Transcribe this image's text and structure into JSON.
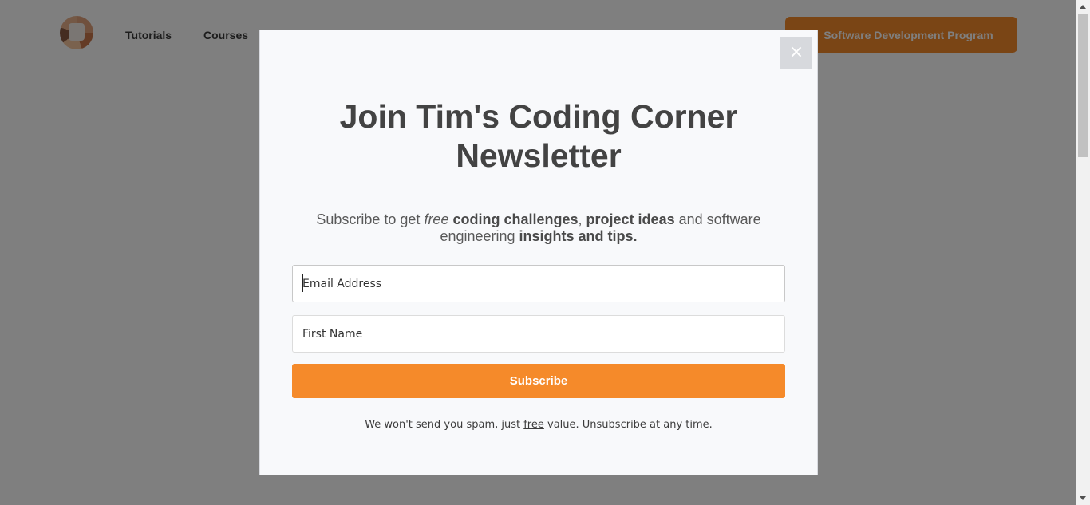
{
  "header": {
    "nav": {
      "tutorials_label": "Tutorials",
      "courses_label": "Courses"
    },
    "cta_label": "Software Development Program"
  },
  "modal": {
    "close_label": "×",
    "title": "Join Tim's Coding Corner Newsletter",
    "subtitle": {
      "prefix": "Subscribe to get ",
      "free": "free",
      "coding_challenges": "coding challenges",
      "comma": ", ",
      "project_ideas": "project ideas",
      "middle": " and software engineering ",
      "insights": "insights and tips."
    },
    "email_field": {
      "placeholder": "Email Address",
      "value": ""
    },
    "first_name_field": {
      "placeholder": "First Name",
      "value": ""
    },
    "subscribe_label": "Subscribe",
    "disclaimer": {
      "prefix": "We won't send you spam, just ",
      "free": "free",
      "suffix": " value. Unsubscribe at any time."
    }
  },
  "colors": {
    "accent": "#f58a2a",
    "overlay": "rgba(0,0,0,0.5)",
    "modal_background": "#f8f9fb",
    "title_text": "#434343"
  },
  "icons": {
    "close": "close-icon",
    "logo": "logo-icon"
  }
}
